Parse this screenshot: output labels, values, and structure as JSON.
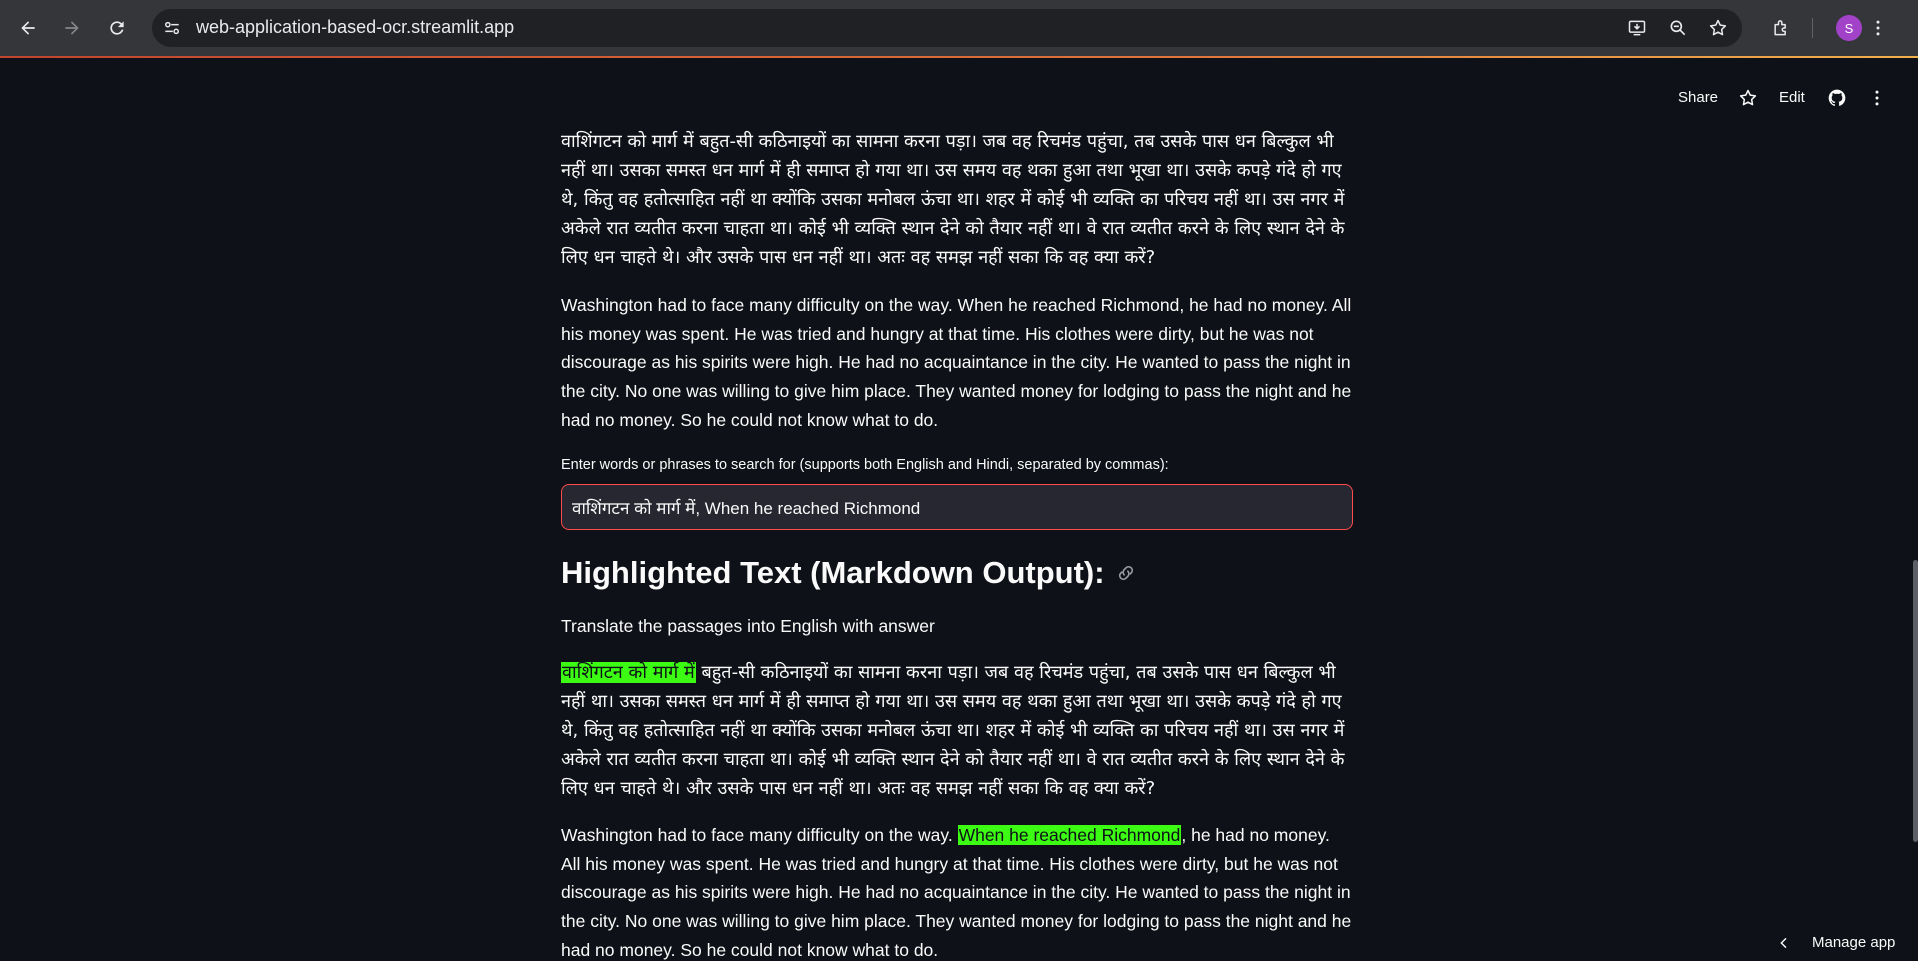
{
  "browser": {
    "url": "web-application-based-ocr.streamlit.app",
    "profile_initial": "S",
    "accent_color": "#a142c9"
  },
  "header": {
    "share_label": "Share",
    "edit_label": "Edit"
  },
  "original": {
    "hindi": "वाशिंगटन को मार्ग में बहुत-सी कठिनाइयों का सामना करना पड़ा। जब वह रिचमंड पहुंचा, तब उसके पास धन बिल्कुल भी नहीं था। उसका समस्त धन मार्ग में ही समाप्त हो गया था। उस समय वह थका हुआ तथा भूखा था। उसके कपड़े गंदे हो गए थे, किंतु वह हतोत्साहित नहीं था क्योंकि उसका मनोबल ऊंचा था। शहर में कोई भी व्यक्ति का परिचय नहीं था। उस नगर में अकेले रात व्यतीत करना चाहता था। कोई भी व्यक्ति स्थान देने को तैयार नहीं था। वे रात व्यतीत करने के लिए स्थान देने के लिए धन चाहते थे। और उसके पास धन नहीं था। अतः वह समझ नहीं सका कि वह क्या करें?",
    "english": "Washington had to face many difficulty on the way. When he reached Richmond, he had no money. All his money was spent. He was tried and hungry at that time. His clothes were dirty, but he was not discourage as his spirits were high. He had no acquaintance in the city. He wanted to pass the night in the city. No one was willing to give him place. They wanted money for lodging to pass the night and he had no money. So he could not know what to do."
  },
  "search": {
    "label": "Enter words or phrases to search for (supports both English and Hindi, separated by commas):",
    "value": "वाशिंगटन को मार्ग में, When he reached Richmond"
  },
  "output": {
    "heading": "Highlighted Text (Markdown Output):",
    "intro": "Translate the passages into English with answer",
    "hindi_highlight": "वाशिंगटन को मार्ग में",
    "hindi_rest": " बहुत-सी कठिनाइयों का सामना करना पड़ा। जब वह रिचमंड पहुंचा, तब उसके पास धन बिल्कुल भी नहीं था। उसका समस्त धन मार्ग में ही समाप्त हो गया था। उस समय वह थका हुआ तथा भूखा था। उसके कपड़े गंदे हो गए थे, किंतु वह हतोत्साहित नहीं था क्योंकि उसका मनोबल ऊंचा था। शहर में कोई भी व्यक्ति का परिचय नहीं था। उस नगर में अकेले रात व्यतीत करना चाहता था। कोई भी व्यक्ति स्थान देने को तैयार नहीं था। वे रात व्यतीत करने के लिए स्थान देने के लिए धन चाहते थे। और उसके पास धन नहीं था। अतः वह समझ नहीं सका कि वह क्या करें?",
    "english_before": "Washington had to face many difficulty on the way. ",
    "english_highlight": "When he reached Richmond",
    "english_after": ", he had no money. All his money was spent. He was tried and hungry at that time. His clothes were dirty, but he was not discourage as his spirits were high. He had no acquaintance in the city. He wanted to pass the night in the city. No one was willing to give him place. They wanted money for lodging to pass the night and he had no money. So he could not know what to do.",
    "highlight_color": "#3cfc14"
  },
  "footer": {
    "manage_label": "Manage app"
  }
}
